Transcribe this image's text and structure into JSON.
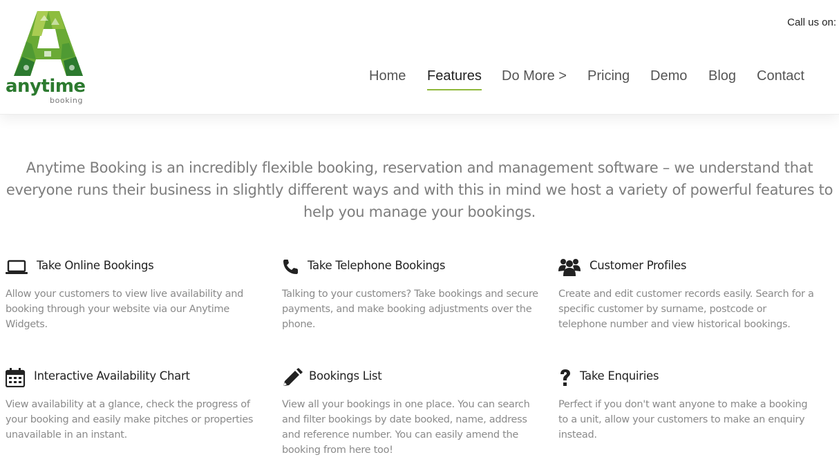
{
  "brand": {
    "name": "anytime",
    "sub": "booking"
  },
  "header": {
    "call_us": "Call us on:"
  },
  "nav": {
    "items": [
      {
        "label": "Home"
      },
      {
        "label": "Features"
      },
      {
        "label": "Do More >"
      },
      {
        "label": "Pricing"
      },
      {
        "label": "Demo"
      },
      {
        "label": "Blog"
      },
      {
        "label": "Contact"
      }
    ],
    "active": "Features",
    "accent": "#8fb83a"
  },
  "intro": {
    "text": "Anytime Booking is an incredibly flexible booking, reservation and management software – we understand that everyone runs their business in slightly different ways and with this in mind we host a variety of powerful features to help you manage your bookings."
  },
  "features": [
    {
      "icon": "laptop-icon",
      "title": "Take Online Bookings",
      "desc": "Allow your customers to view live availability and booking through your website via our Anytime Widgets."
    },
    {
      "icon": "phone-icon",
      "title": "Take Telephone Bookings",
      "desc": "Talking to your customers? Take bookings and secure payments, and make booking adjustments over the phone."
    },
    {
      "icon": "users-icon",
      "title": "Customer Profiles",
      "desc": "Create and edit customer records easily. Search for a specific customer by surname, postcode or telephone number and view historical bookings."
    },
    {
      "icon": "calendar-icon",
      "title": "Interactive Availability Chart",
      "desc": "View availability at a glance, check the progress of your booking and easily make pitches or properties unavailable in an instant."
    },
    {
      "icon": "pencil-icon",
      "title": "Bookings List",
      "desc": "View all your bookings in one place. You can search and filter bookings by date booked, name, address and reference number. You can easily amend the booking from here too!"
    },
    {
      "icon": "question-icon",
      "title": "Take Enquiries",
      "desc": "Perfect if you don't want anyone to make a booking to a unit, allow your customers to make an enquiry instead."
    }
  ],
  "colors": {
    "brand_green": "#2c7a2f",
    "light_green": "#8fb83a"
  }
}
